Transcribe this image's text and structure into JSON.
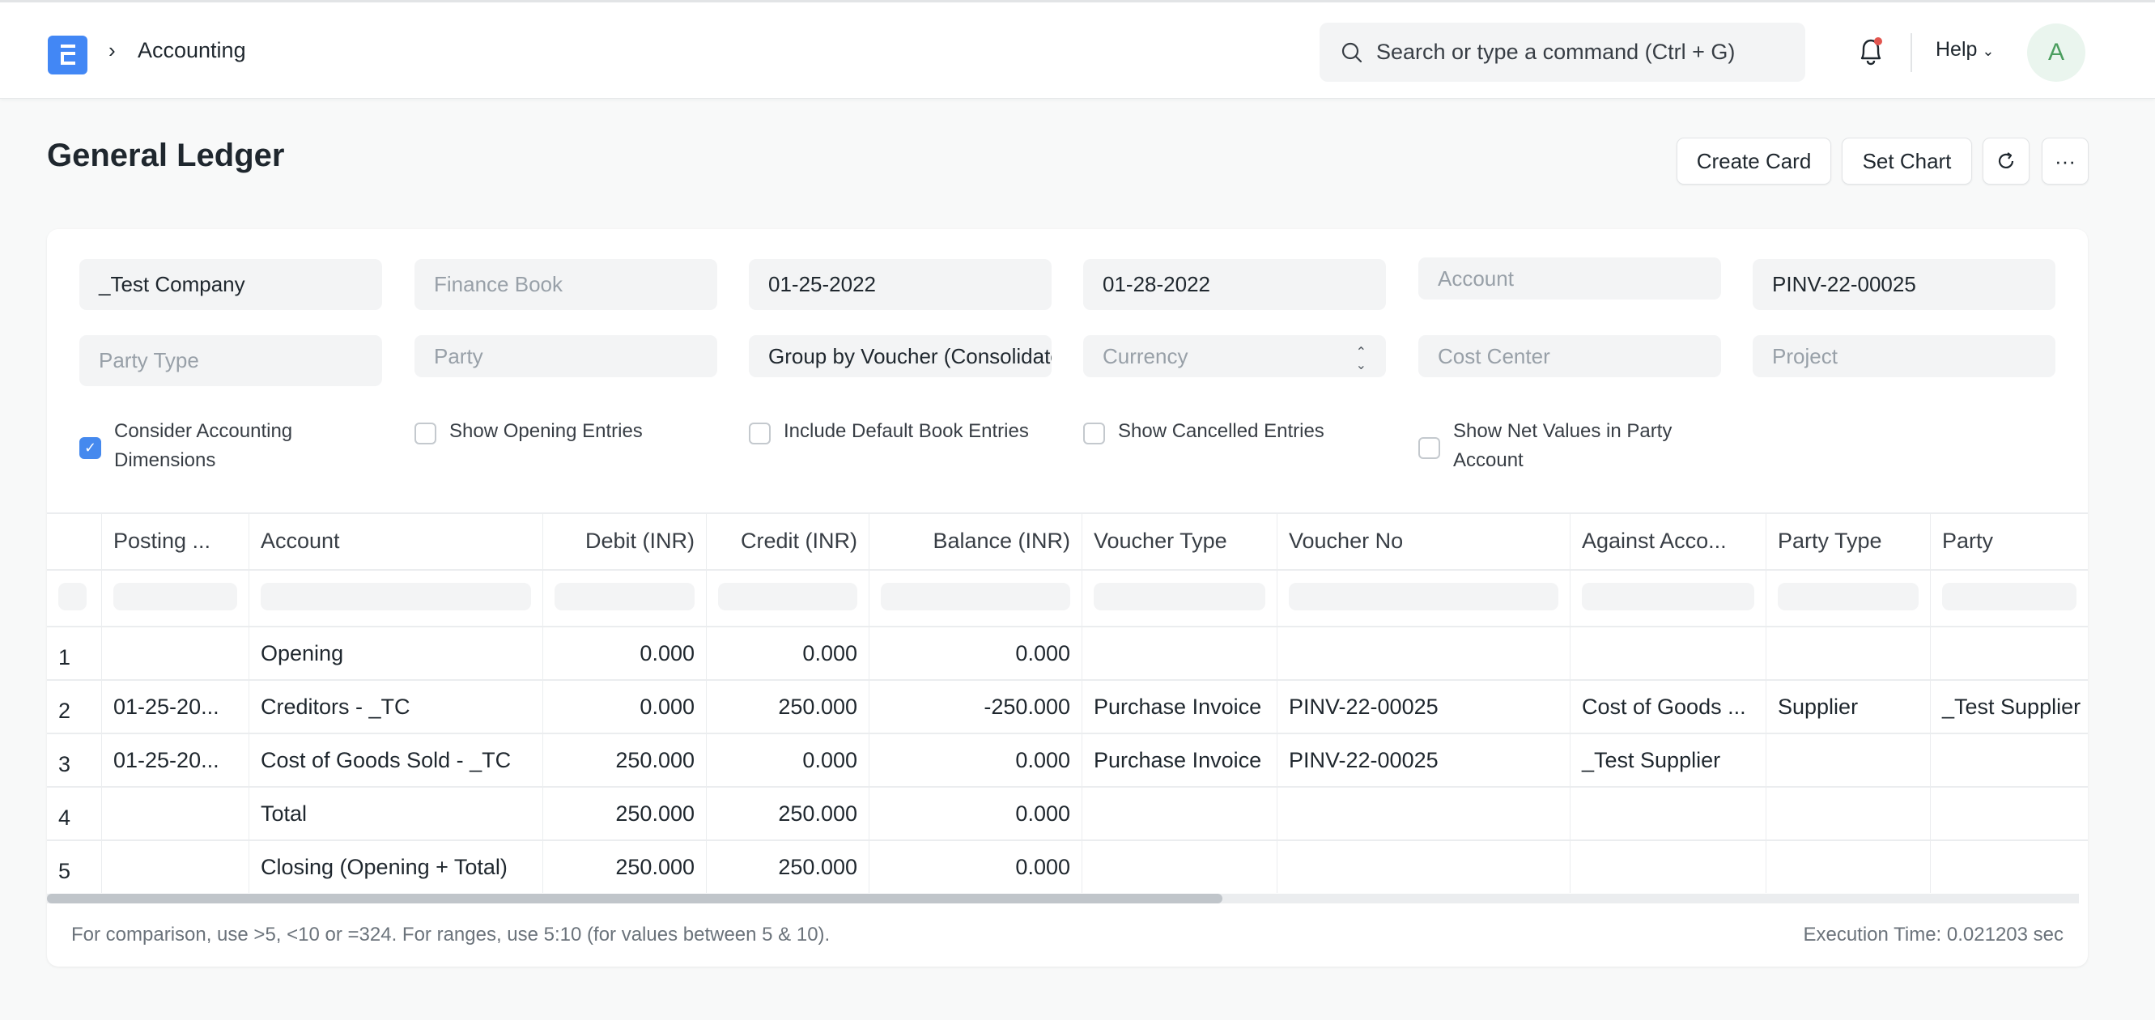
{
  "navbar": {
    "breadcrumb": "Accounting",
    "search_placeholder": "Search or type a command (Ctrl + G)",
    "help_label": "Help",
    "avatar_initial": "A",
    "accent_color": "#4287f5",
    "notification_dot_color": "#e2554f"
  },
  "page": {
    "title": "General Ledger",
    "buttons": {
      "create_card": "Create Card",
      "set_chart": "Set Chart",
      "refresh": "↻",
      "more": "···"
    }
  },
  "filters": {
    "company": "_Test Company",
    "finance_book_placeholder": "Finance Book",
    "from_date": "01-25-2022",
    "to_date": "01-28-2022",
    "account_placeholder": "Account",
    "voucher_no": "PINV-22-00025",
    "party_type_placeholder": "Party Type",
    "party_placeholder": "Party",
    "group_by": "Group by Voucher (Consolidated)",
    "currency_placeholder": "Currency",
    "cost_center_placeholder": "Cost Center",
    "project_placeholder": "Project",
    "checkboxes": [
      {
        "label": "Consider Accounting Dimensions",
        "checked": true
      },
      {
        "label": "Show Opening Entries",
        "checked": false
      },
      {
        "label": "Include Default Book Entries",
        "checked": false
      },
      {
        "label": "Show Cancelled Entries",
        "checked": false
      },
      {
        "label": "Show Net Values in Party Account",
        "checked": false
      }
    ]
  },
  "table": {
    "columns": [
      "Posting ...",
      "Account",
      "Debit (INR)",
      "Credit (INR)",
      "Balance (INR)",
      "Voucher Type",
      "Voucher No",
      "Against Acco...",
      "Party Type",
      "Party"
    ],
    "rows": [
      {
        "n": "1",
        "posting": "",
        "account": "Opening",
        "debit": "0.000",
        "credit": "0.000",
        "balance": "0.000",
        "voucher_type": "",
        "voucher_no": "",
        "against": "",
        "party_type": "",
        "party": ""
      },
      {
        "n": "2",
        "posting": "01-25-20...",
        "account": "Creditors - _TC",
        "debit": "0.000",
        "credit": "250.000",
        "balance": "-250.000",
        "voucher_type": "Purchase Invoice",
        "voucher_no": "PINV-22-00025",
        "against": "Cost of Goods ...",
        "party_type": "Supplier",
        "party": "_Test Supplier"
      },
      {
        "n": "3",
        "posting": "01-25-20...",
        "account": "Cost of Goods Sold - _TC",
        "debit": "250.000",
        "credit": "0.000",
        "balance": "0.000",
        "voucher_type": "Purchase Invoice",
        "voucher_no": "PINV-22-00025",
        "against": "_Test Supplier",
        "party_type": "",
        "party": ""
      },
      {
        "n": "4",
        "posting": "",
        "account": "Total",
        "debit": "250.000",
        "credit": "250.000",
        "balance": "0.000",
        "voucher_type": "",
        "voucher_no": "",
        "against": "",
        "party_type": "",
        "party": ""
      },
      {
        "n": "5",
        "posting": "",
        "account": "Closing (Opening + Total)",
        "debit": "250.000",
        "credit": "250.000",
        "balance": "0.000",
        "voucher_type": "",
        "voucher_no": "",
        "against": "",
        "party_type": "",
        "party": ""
      }
    ]
  },
  "footer": {
    "hint": "For comparison, use >5, <10 or =324. For ranges, use 5:10 (for values between 5 & 10).",
    "execution_time": "Execution Time: 0.021203 sec"
  }
}
